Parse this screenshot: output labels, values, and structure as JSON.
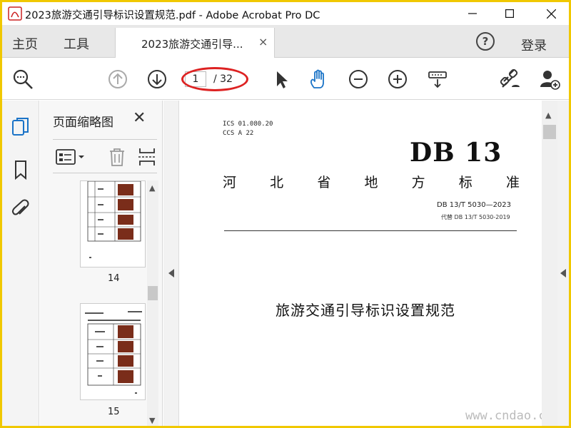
{
  "window": {
    "title": "2023旅游交通引导标识设置规范.pdf - Adobe Acrobat Pro DC"
  },
  "tabs": {
    "home": "主页",
    "tools": "工具",
    "document": "2023旅游交通引导...",
    "close": "×",
    "help": "?",
    "login": "登录"
  },
  "toolbar": {
    "page_current": "1",
    "page_total": "/ 32"
  },
  "panel": {
    "title": "页面缩略图",
    "close": "✕",
    "thumbnails": [
      {
        "label": "14"
      },
      {
        "label": "15"
      }
    ]
  },
  "document": {
    "ics": "ICS  01.080.20",
    "ccs": "CCS  A 22",
    "db_mark": "DB 13",
    "province_chars": [
      "河",
      "北",
      "省",
      "地",
      "方",
      "标",
      "准"
    ],
    "standard_code": "DB 13/T  5030—2023",
    "replaces": "代替 DB 13/T 5030-2019",
    "title": "旅游交通引导标识设置规范"
  },
  "watermark": "www.cndao.com",
  "colors": {
    "accent_blue": "#1a73c7",
    "highlight_red": "#d22222",
    "frame_yellow": "#f0c800"
  }
}
